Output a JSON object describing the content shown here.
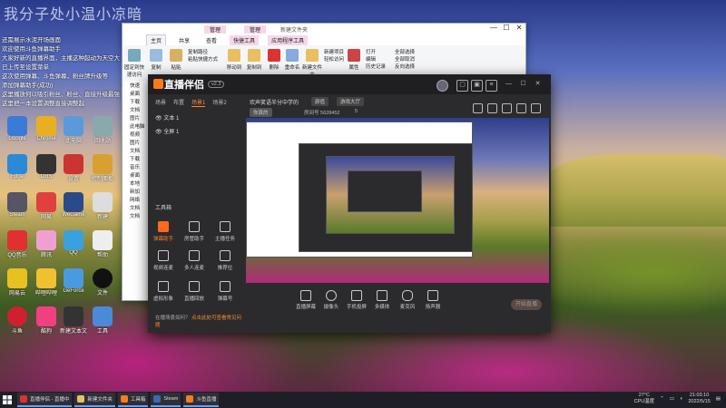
{
  "overlay": {
    "title": "我分子处小温小凉暗",
    "notes": [
      "还需展示水泥开场画面",
      "欢迎使用斗鱼弹幕助手",
      "大家好新的直播界面，主播这种起动为天空大",
      "已上传至设置菜单",
      "这次使用弹幕、斗鱼弹幕，粉丝牌升级等",
      "添加弹幕助手(成功)",
      "这里播放何以吸引粉丝、粉丝、直接升级最强",
      "这里把一本设置调整直接调整起"
    ]
  },
  "desktop": {
    "icons": [
      {
        "label": "Google"
      },
      {
        "label": "Chrome"
      },
      {
        "label": "此电脑"
      },
      {
        "label": "回收站"
      },
      {
        "label": "Edge"
      },
      {
        "label": "OBS"
      },
      {
        "label": "设置"
      },
      {
        "label": "控制面板"
      },
      {
        "label": "Steam"
      },
      {
        "label": "网易"
      },
      {
        "label": "WeGame"
      },
      {
        "label": "新建"
      },
      {
        "label": "QQ音乐"
      },
      {
        "label": "腾讯"
      },
      {
        "label": "QQ"
      },
      {
        "label": "帮助"
      },
      {
        "label": "网易云"
      },
      {
        "label": "哔哩哔哩"
      },
      {
        "label": "GeForce"
      },
      {
        "label": "文件"
      },
      {
        "label": "斗鱼"
      },
      {
        "label": "酷狗"
      },
      {
        "label": "新建文本文档"
      },
      {
        "label": "工具"
      }
    ]
  },
  "explorer": {
    "tabs": [
      "主页",
      "共享",
      "查看",
      "快捷工具",
      "应用程序工具"
    ],
    "context_tabs": [
      "管理",
      "管理"
    ],
    "title": "新建文件夹",
    "ribbon": {
      "buttons": [
        "固定到快速访问",
        "复制",
        "粘贴",
        "移动到",
        "复制到",
        "删除",
        "重命名",
        "新建文件夹",
        "属性"
      ],
      "clip_list": [
        "复制路径",
        "粘贴快捷方式"
      ],
      "new_list": [
        "新建项目",
        "轻松访问"
      ],
      "open_list": [
        "打开",
        "编辑",
        "历史记录"
      ],
      "select_list": [
        "全部选择",
        "全部取消",
        "反向选择"
      ]
    },
    "nav": [
      "快速",
      "桌面",
      "下载",
      "文档",
      "图片",
      "此电脑",
      "视频",
      "图片",
      "文档",
      "下载",
      "音乐",
      "桌面",
      "本地",
      "新加",
      "网络",
      "文档",
      "文档"
    ]
  },
  "stream_app": {
    "logo": "直播伴侣",
    "version": "v2.3",
    "source_tabs": [
      "场景",
      "布置",
      "场景1",
      "场景2"
    ],
    "sources": [
      "文本 1",
      "全屏 1"
    ],
    "room_title": "欢声笑语半分中学的",
    "chip1": "颜值",
    "chip2": "游戏大厅",
    "chip_live": "你真的",
    "room_id": "房间号 5628452",
    "viewers": "5",
    "tools_title": "工具箱",
    "tools": [
      {
        "label": "弹幕助手",
        "hot": true
      },
      {
        "label": "房管助手",
        "hot": false
      },
      {
        "label": "主播任务",
        "hot": false
      },
      {
        "label": "视频连麦",
        "hot": false
      },
      {
        "label": "多人连麦",
        "hot": false
      },
      {
        "label": "推荐位",
        "hot": false
      },
      {
        "label": "虚拟形象",
        "hot": false
      },
      {
        "label": "直播回放",
        "hot": false
      },
      {
        "label": "弹幕号",
        "hot": false
      }
    ],
    "notice_text": "在播场景如何？",
    "notice_link": "点击此处可查看常见问题",
    "controls": [
      "直播屏幕",
      "摄像头",
      "手机投屏",
      "多媒体",
      "麦克风",
      "扬声器"
    ],
    "go_live": "开始直播"
  },
  "taskbar": {
    "items": [
      "直播伴侣 - 直播中",
      "新建文件夹",
      "工具箱",
      "Steam",
      "斗鱼直播"
    ],
    "weather": "27°C",
    "cpu": "CPU温度",
    "time": "21:03:10",
    "date": "2022/5/15"
  },
  "colors": {
    "accent": "#ff7a1a",
    "taskbar": "#1e1f26",
    "app_bg": "#2b2b2e"
  }
}
